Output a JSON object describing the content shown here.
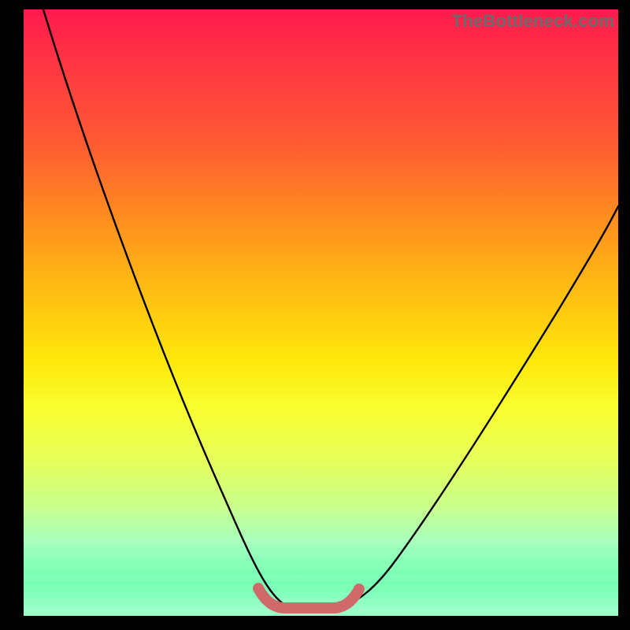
{
  "watermark": {
    "text": "TheBottleneck.com"
  },
  "colors": {
    "background": "#000000",
    "curve": "#000000",
    "marker": "#d06a6a"
  },
  "chart_data": {
    "type": "line",
    "title": "",
    "xlabel": "",
    "ylabel": "",
    "xlim": [
      0,
      100
    ],
    "ylim": [
      0,
      100
    ],
    "x": [
      0,
      5,
      10,
      15,
      20,
      25,
      30,
      35,
      38,
      40,
      42,
      44,
      46,
      48,
      50,
      52,
      54,
      58,
      62,
      68,
      75,
      82,
      90,
      100
    ],
    "values": [
      100,
      89,
      78,
      67,
      57,
      47,
      37,
      26,
      17,
      11,
      6,
      3,
      1,
      0,
      0,
      0,
      1,
      5,
      12,
      20,
      30,
      40,
      50,
      62
    ],
    "annotations": [
      {
        "type": "minimum-marker",
        "x_range": [
          40,
          56
        ],
        "y": 0
      }
    ],
    "gradient_stops": [
      {
        "pos": 0.0,
        "color": "#ff1a4d"
      },
      {
        "pos": 0.3,
        "color": "#ff8c1f"
      },
      {
        "pos": 0.6,
        "color": "#ffe80a"
      },
      {
        "pos": 0.85,
        "color": "#9affb5"
      },
      {
        "pos": 1.0,
        "color": "#00ff7a"
      }
    ]
  }
}
